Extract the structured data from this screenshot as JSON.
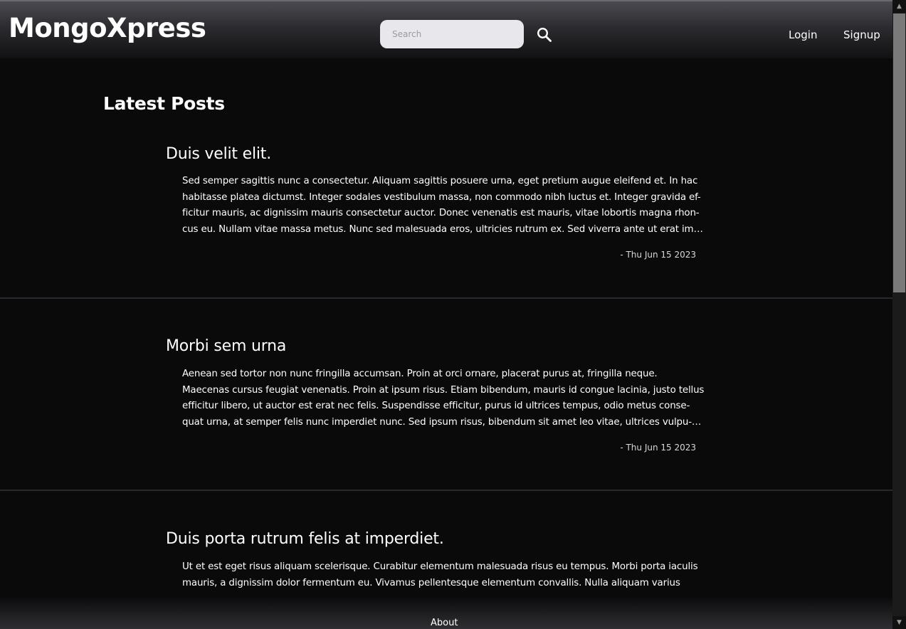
{
  "header": {
    "logo": "MongoXpress",
    "search": {
      "placeholder": "Search",
      "value": ""
    },
    "nav": {
      "login": "Login",
      "signup": "Signup"
    }
  },
  "main": {
    "heading": "Latest Posts",
    "posts": [
      {
        "title": "Duis velit elit.",
        "excerpt": "Sed semper sagittis nunc a consectetur. Aliquam sagittis posuere urna, eget pretium augue eleifend et. In hac habitasse platea dictumst. Integer sodales vestibulum massa, non commodo nibh luctus et. Integer gravida ef-ficitur mauris, ac dignissim mauris consectetur auctor. Donec venenatis est mauris, vitae lobortis magna rhon-cus eu. Nullam vitae massa metus. Nunc sed malesuada eros, ultricies rutrum ex. Sed viverra ante ut erat im-perdiet, vitae consectetur turpis vestibulum.",
        "date": "- Thu Jun 15 2023"
      },
      {
        "title": "Morbi sem urna",
        "excerpt": "Aenean sed tortor non nunc fringilla accumsan. Proin at orci ornare, placerat purus at, fringilla neque. Maecenas cursus feugiat venenatis. Proin at ipsum risus. Etiam bibendum, mauris id congue lacinia, justo tellus efficitur libero, ut auctor est erat nec felis. Suspendisse efficitur, purus id ultrices tempus, odio metus conse-quat urna, at semper felis nunc imperdiet nunc. Sed ipsum risus, bibendum sit amet leo vitae, ultrices vulpu-tate nibh.",
        "date": "- Thu Jun 15 2023"
      },
      {
        "title": "Duis porta rutrum felis at imperdiet.",
        "excerpt": "Ut et est eget risus aliquam scelerisque. Curabitur elementum malesuada risus eu tempus. Morbi porta iaculis mauris, a dignissim dolor fermentum eu. Vivamus pellentesque elementum convallis. Nulla aliquam varius",
        "date": ""
      }
    ]
  },
  "footer": {
    "about": "About"
  },
  "icons": {
    "search": "search-icon",
    "scroll_up": "chevron-up-icon",
    "scroll_down": "chevron-down-icon"
  },
  "colors": {
    "background": "#0a0a0b",
    "header_top": "#4a4a50",
    "search_bg": "#e8e8ec",
    "divider": "#2a2a2e",
    "text": "#ffffff"
  }
}
